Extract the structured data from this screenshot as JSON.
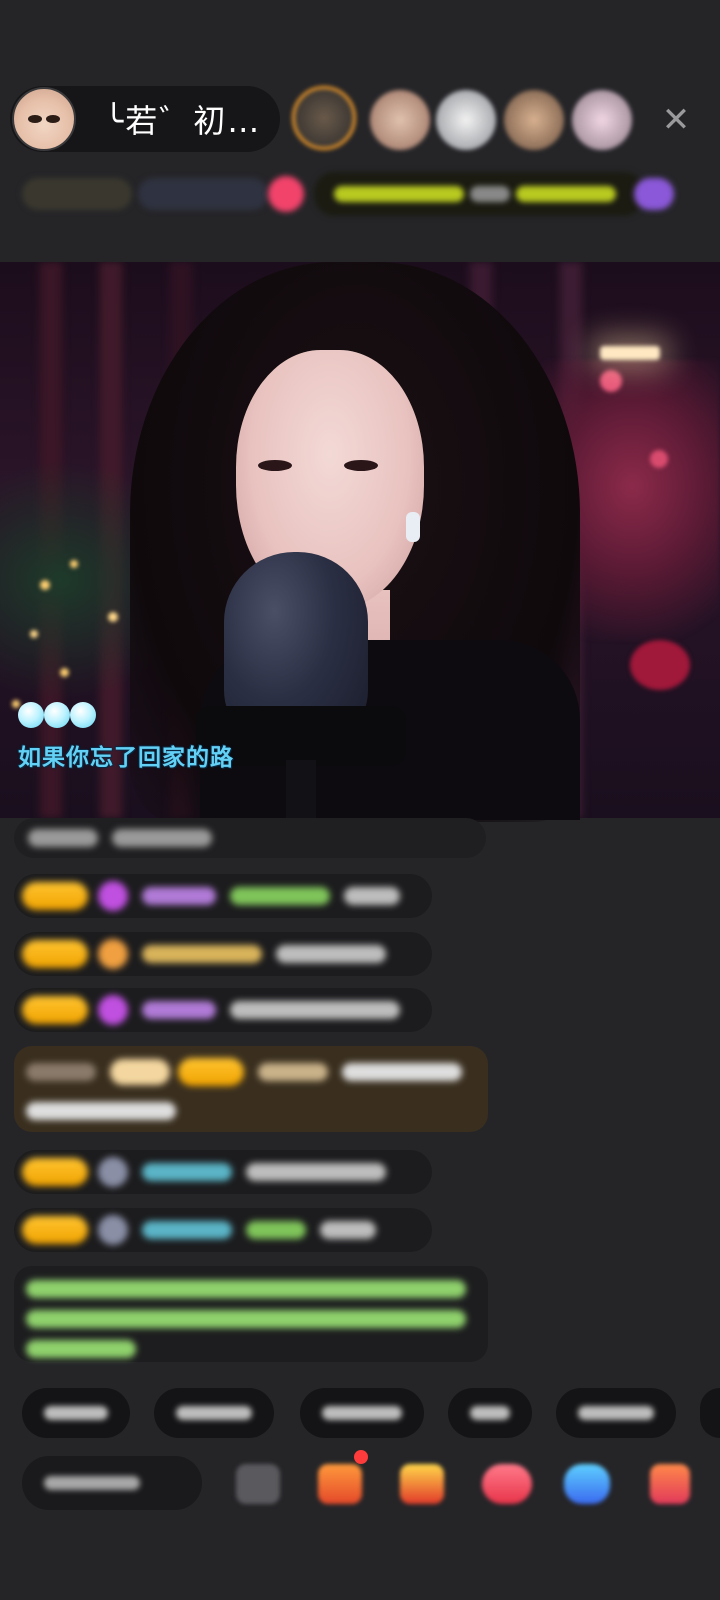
{
  "header": {
    "host_name": "╰若゛初…",
    "close_icon": "close-icon",
    "viewer_avatar_colors": [
      "#d4883a",
      "#c9a08c",
      "#dfe2e6",
      "#b98e70",
      "#d9b7c6"
    ]
  },
  "video": {
    "lyric": "如果你忘了回家的路",
    "bubble_icons": 3
  },
  "chat": {
    "message_count": 7,
    "badge_color": "#f5b21b",
    "highlight_background": "#3a2f1f",
    "system_text_color": "#8fd16c"
  },
  "quick_replies_count": 6,
  "bottom_bar": {
    "icons": [
      "screen-icon",
      "gift-box-icon",
      "treasure-icon",
      "game-icon",
      "message-icon",
      "grid-icon"
    ]
  }
}
